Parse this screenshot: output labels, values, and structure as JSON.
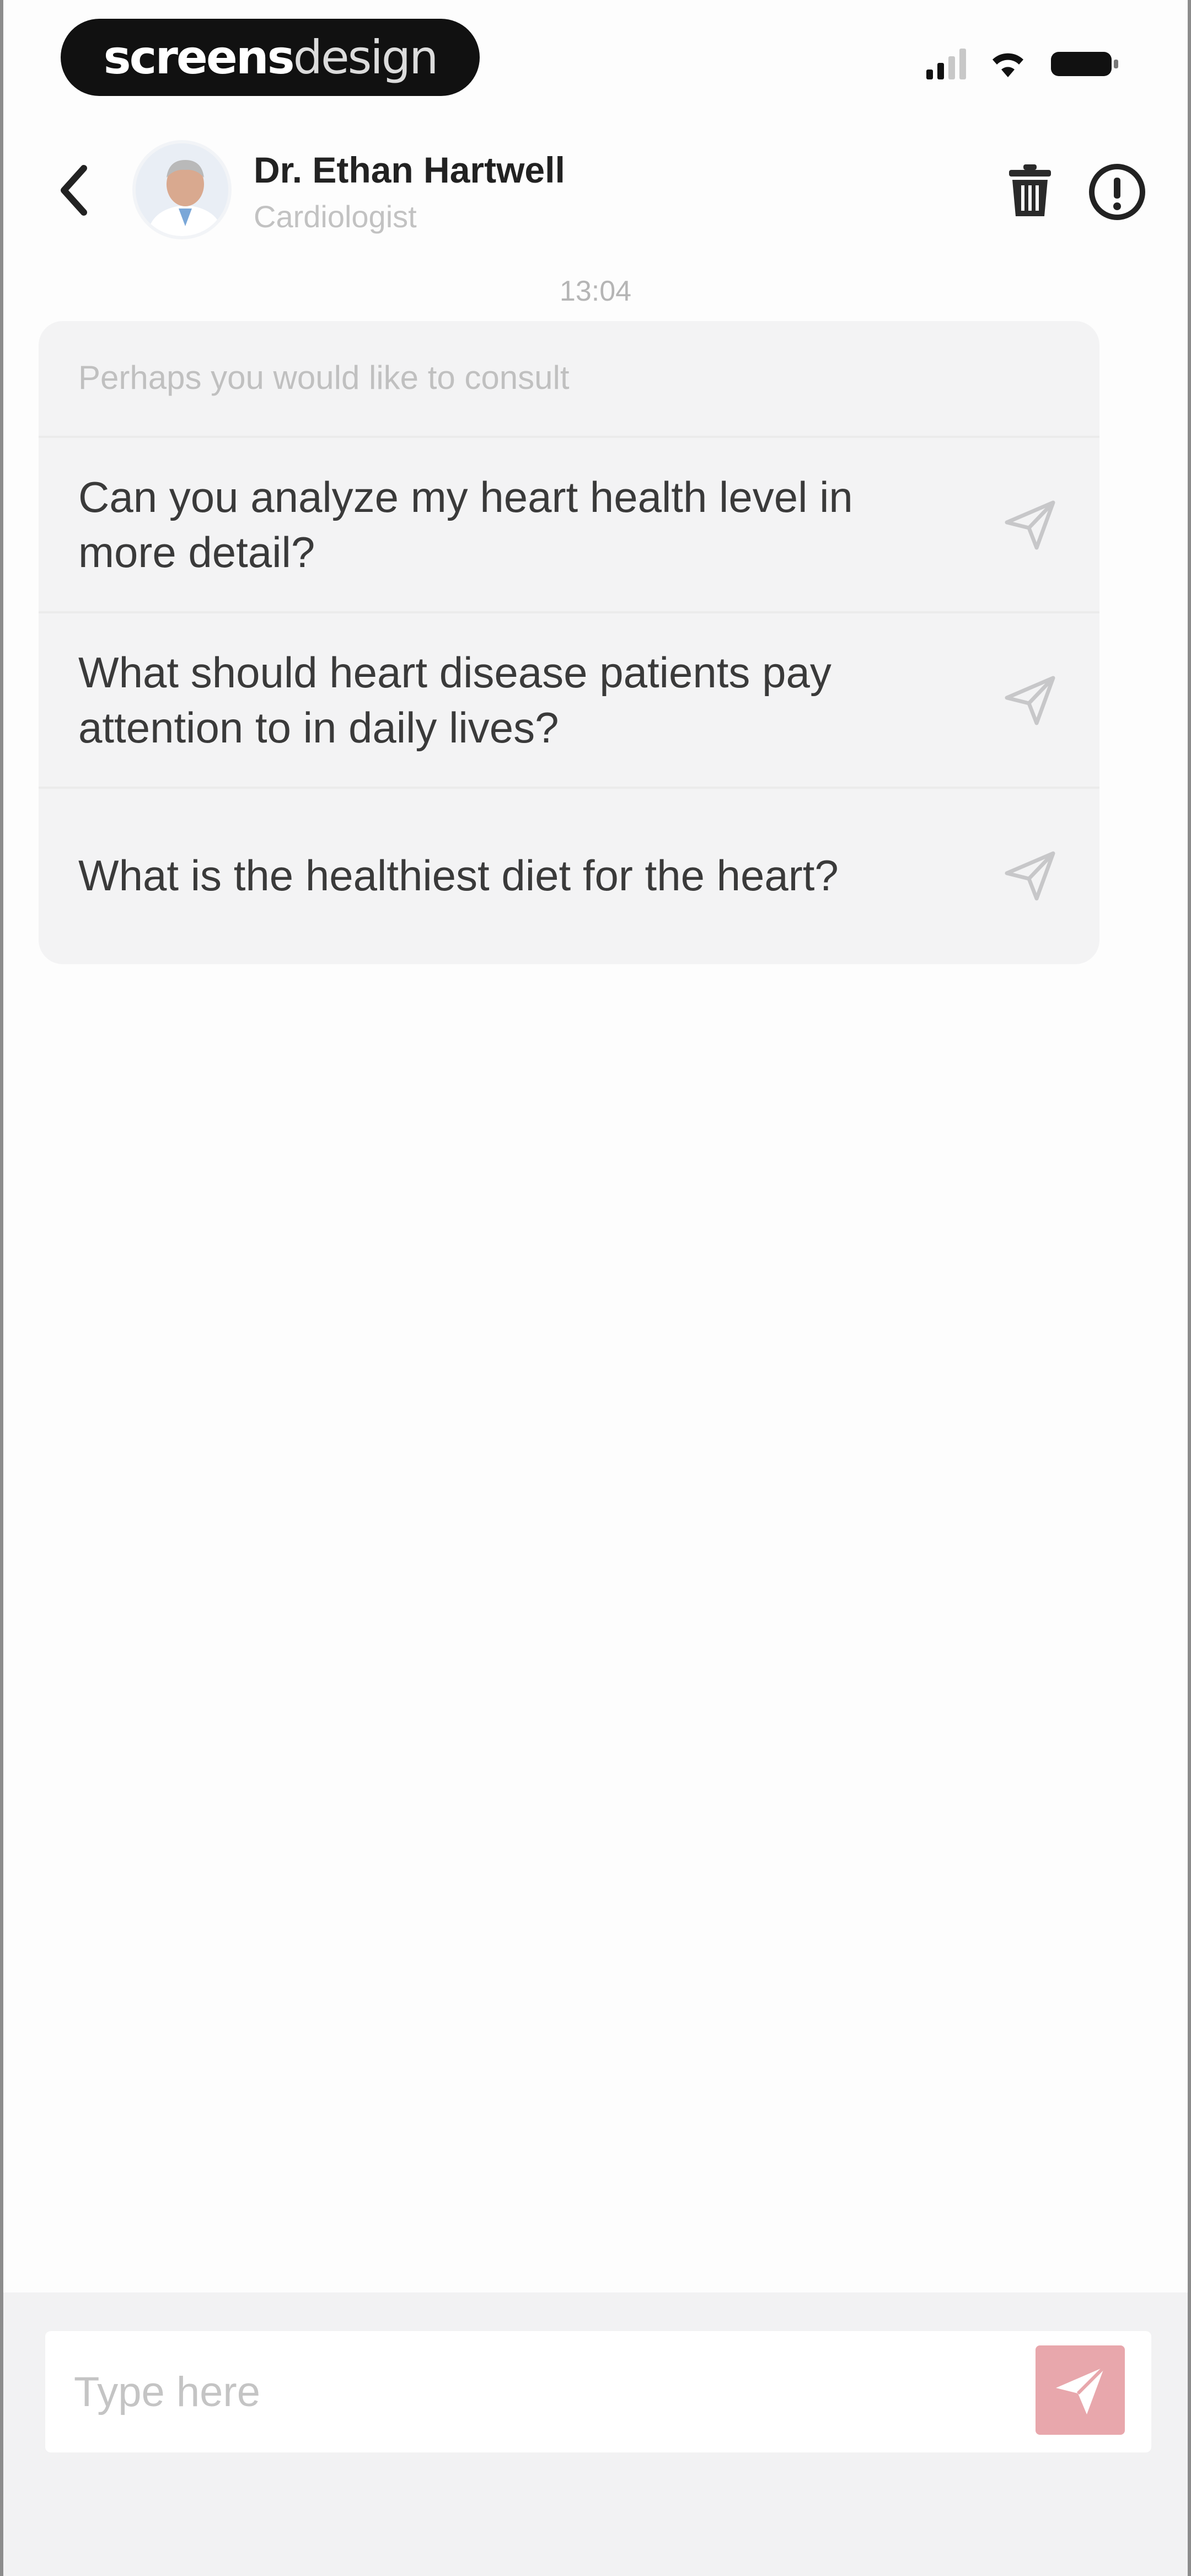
{
  "status_bar": {
    "brand_bold": "screens",
    "brand_light": "design",
    "icons": [
      "signal-icon",
      "wifi-icon",
      "battery-icon"
    ]
  },
  "header": {
    "back_icon": "chevron-left-icon",
    "doctor_name": "Dr. Ethan Hartwell",
    "doctor_role": "Cardiologist",
    "trash_icon": "trash-icon",
    "info_icon": "info-icon"
  },
  "chat": {
    "timestamp": "13:04",
    "suggestions": {
      "header": "Perhaps you would like to consult",
      "items": [
        {
          "text": "Can you analyze my heart health level in more detail?",
          "icon": "send-icon"
        },
        {
          "text": "What should heart disease patients pay attention to in daily lives?",
          "icon": "send-icon"
        },
        {
          "text": "What is the healthiest diet for the heart?",
          "icon": "send-icon"
        }
      ]
    }
  },
  "composer": {
    "placeholder": "Type here",
    "value": "",
    "send_icon": "send-icon"
  },
  "colors": {
    "send_button": "#e8a7ac",
    "card_bg": "#f3f3f4",
    "composer_bg": "#f2f2f3"
  }
}
